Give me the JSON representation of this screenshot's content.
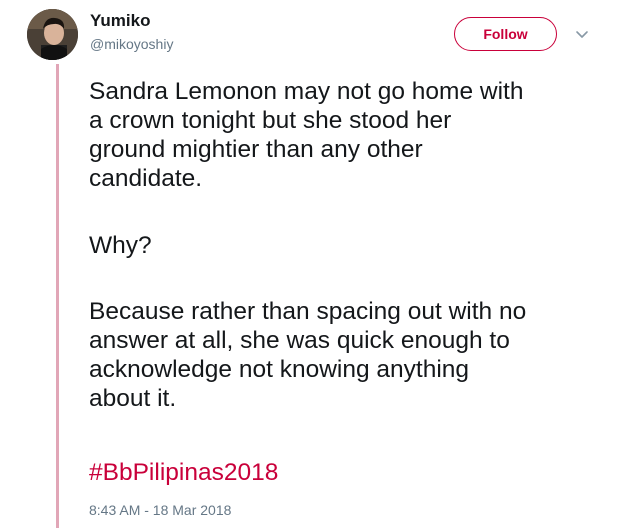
{
  "tweet": {
    "author": {
      "name": "Yumiko",
      "handle": "@mikoyoshiy"
    },
    "follow_label": "Follow",
    "text": {
      "paragraph_1": "Sandra Lemonon may not go home with\na crown tonight but she stood her\nground mightier than any other\ncandidate.",
      "paragraph_2": "Why?",
      "paragraph_3": "Because rather than spacing out with no\nanswer at all, she was quick enough to\nacknowledge not knowing anything\nabout it."
    },
    "hashtag": "#BbPilipinas2018",
    "timestamp": "8:43 AM - 18 Mar 2018"
  },
  "colors": {
    "accent": "#c9003a",
    "thread_line": "#e1a6b7",
    "secondary_text": "#657786",
    "primary_text": "#14171a"
  },
  "icons": {
    "avatar": "user-avatar",
    "menu": "chevron-down-icon"
  }
}
